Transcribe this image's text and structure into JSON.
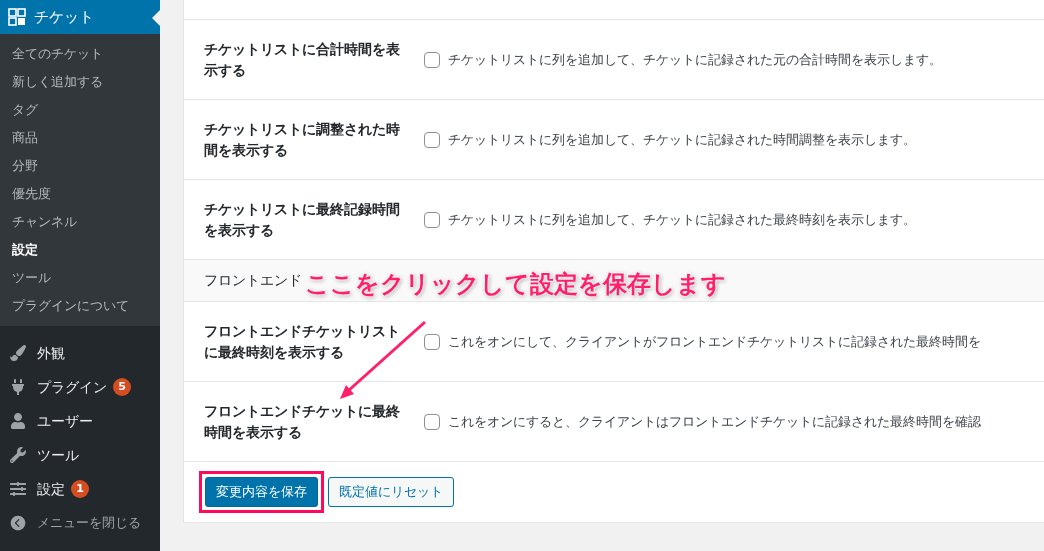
{
  "sidebar": {
    "current": {
      "label": "チケット",
      "selected": true
    },
    "submenu": [
      {
        "label": "全てのチケット",
        "selected": false
      },
      {
        "label": "新しく追加する",
        "selected": false
      },
      {
        "label": "タグ",
        "selected": false
      },
      {
        "label": "商品",
        "selected": false
      },
      {
        "label": "分野",
        "selected": false
      },
      {
        "label": "優先度",
        "selected": false
      },
      {
        "label": "チャンネル",
        "selected": false
      },
      {
        "label": "設定",
        "selected": true
      },
      {
        "label": "ツール",
        "selected": false
      },
      {
        "label": "プラグインについて",
        "selected": false
      }
    ],
    "items": [
      {
        "kind": "brush",
        "label": "外観"
      },
      {
        "kind": "plug",
        "label": "プラグイン",
        "badge": "5"
      },
      {
        "kind": "user",
        "label": "ユーザー"
      },
      {
        "kind": "wrench",
        "label": "ツール"
      },
      {
        "kind": "sliders",
        "label": "設定",
        "badge": "1"
      }
    ],
    "collapse": "メニューを閉じる"
  },
  "settings": [
    {
      "kind": "row",
      "label": "チケットリストに合計時間を表示する",
      "checked": false,
      "description": "チケットリストに列を追加して、チケットに記録された元の合計時間を表示します。"
    },
    {
      "kind": "row",
      "label": "チケットリストに調整された時間を表示する",
      "checked": false,
      "description": "チケットリストに列を追加して、チケットに記録された時間調整を表示します。"
    },
    {
      "kind": "row",
      "label": "チケットリストに最終記録時間を表示する",
      "checked": false,
      "description": "チケットリストに列を追加して、チケットに記録された最終時刻を表示します。"
    },
    {
      "kind": "heading",
      "label": "フロントエンド"
    },
    {
      "kind": "row",
      "label": "フロントエンドチケットリストに最終時刻を表示する",
      "checked": false,
      "description": "これをオンにして、クライアントがフロントエンドチケットリストに記録された最終時間を"
    },
    {
      "kind": "row",
      "label": "フロントエンドチケットに最終時間を表示する",
      "checked": false,
      "description": "これをオンにすると、クライアントはフロントエンドチケットに記録された最終時間を確認"
    }
  ],
  "buttons": [
    {
      "kind": "primary",
      "label": "変更内容を保存"
    },
    {
      "kind": "secondary",
      "label": "既定値にリセット"
    }
  ],
  "annotation": {
    "text": "ここをクリックして設定を保存します"
  }
}
